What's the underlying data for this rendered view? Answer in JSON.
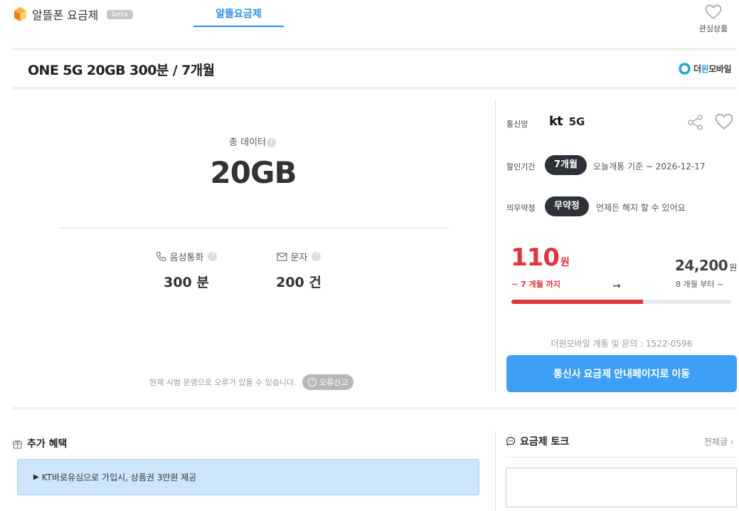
{
  "header": {
    "brand": "알뜰폰 요금제",
    "beta": "beta",
    "nav_tab": "알뜰요금제",
    "favorites_label": "관심상품"
  },
  "plan": {
    "title": "ONE 5G 20GB 300분 / 7개월",
    "carrier_brand_prefix": "더",
    "carrier_brand_highlight": "원",
    "carrier_brand_suffix": "모바일"
  },
  "specs": {
    "data_label": "총 데이터",
    "data_value": "20GB",
    "voice_label": "음성통화",
    "voice_value": "300 분",
    "sms_label": "문자",
    "sms_value": "200 건",
    "help_mark": "?"
  },
  "notice": {
    "text": "현재 시범 운영으로 오류가 있을 수 있습니다.",
    "report_label": "오류신고"
  },
  "info": {
    "network_label": "통신망",
    "network_brand": "kt",
    "network_type": "5G",
    "discount_label": "할인기간",
    "discount_period": "7개월",
    "discount_note": "오늘개통 기준 ~ 2026-12-17",
    "contract_label": "의무약정",
    "contract_value": "무약정",
    "contract_note": "언제든 해지 할 수 있어요"
  },
  "pricing": {
    "promo_price": "110",
    "promo_unit": "원",
    "promo_until": "~ 7 개월 까지",
    "arrow": "→",
    "regular_price": "24,200",
    "regular_unit": "원",
    "regular_from": "8 개월 부터 ~",
    "progress_fraction": 0.6
  },
  "contact": {
    "text": "더원모바일 개통 및 문의 : 1522-0596",
    "cta_label": "통신사 요금제 안내페이지로 이동"
  },
  "benefits": {
    "title": "추가 혜택",
    "item": "KT바로유심으로 가입시, 상품권 3만원 제공"
  },
  "talk": {
    "title": "요금제 토크",
    "view_all": "전체글"
  },
  "colors": {
    "accent_blue": "#3d9ff5",
    "promo_red": "#e0353c",
    "pill_dark": "#2e3238"
  }
}
